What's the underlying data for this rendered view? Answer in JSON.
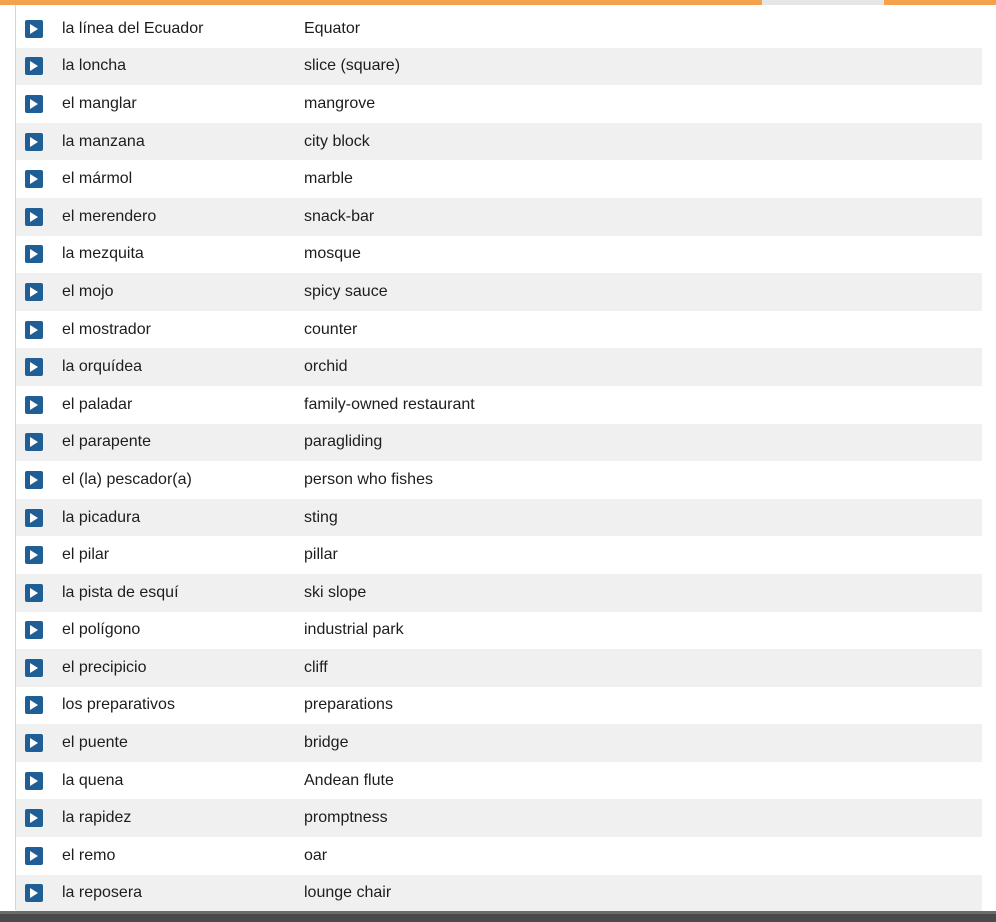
{
  "vocabulary": [
    {
      "term": "la línea del Ecuador",
      "definition": "Equator"
    },
    {
      "term": "la loncha",
      "definition": "slice (square)"
    },
    {
      "term": "el manglar",
      "definition": "mangrove"
    },
    {
      "term": "la manzana",
      "definition": "city block"
    },
    {
      "term": "el mármol",
      "definition": "marble"
    },
    {
      "term": "el merendero",
      "definition": "snack-bar"
    },
    {
      "term": "la mezquita",
      "definition": "mosque"
    },
    {
      "term": "el mojo",
      "definition": "spicy sauce"
    },
    {
      "term": "el mostrador",
      "definition": "counter"
    },
    {
      "term": "la orquídea",
      "definition": "orchid"
    },
    {
      "term": "el paladar",
      "definition": "family-owned restaurant"
    },
    {
      "term": "el parapente",
      "definition": "paragliding"
    },
    {
      "term": "el (la) pescador(a)",
      "definition": "person who fishes"
    },
    {
      "term": "la picadura",
      "definition": "sting"
    },
    {
      "term": "el pilar",
      "definition": "pillar"
    },
    {
      "term": "la pista de esquí",
      "definition": "ski slope"
    },
    {
      "term": "el polígono",
      "definition": "industrial park"
    },
    {
      "term": "el precipicio",
      "definition": "cliff"
    },
    {
      "term": "los preparativos",
      "definition": "preparations"
    },
    {
      "term": "el puente",
      "definition": "bridge"
    },
    {
      "term": "la quena",
      "definition": "Andean flute"
    },
    {
      "term": "la rapidez",
      "definition": "promptness"
    },
    {
      "term": "el remo",
      "definition": "oar"
    },
    {
      "term": "la reposera",
      "definition": "lounge chair"
    }
  ],
  "colors": {
    "accent_bar": "#f5a04a",
    "play_button": "#1f5f95",
    "row_alt": "#f0f0f1"
  },
  "icons": {
    "row_button": "play-icon"
  }
}
